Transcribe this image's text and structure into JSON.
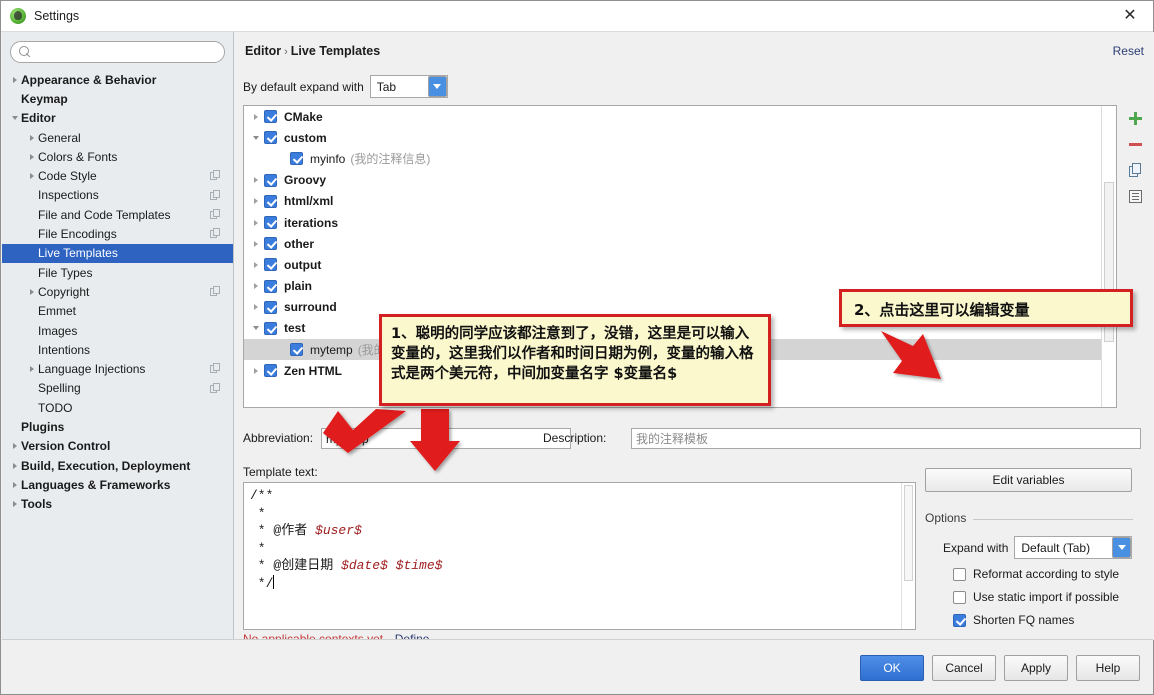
{
  "window": {
    "title": "Settings",
    "app_icon": "intellij-logo-icon",
    "close_label": "✕"
  },
  "sidebar": {
    "search": {
      "value": "",
      "placeholder": "",
      "icon": "search-icon"
    },
    "items": [
      {
        "label": "Appearance & Behavior",
        "level": 0,
        "bold": true,
        "arrow": "right",
        "badge": false,
        "selected": false
      },
      {
        "label": "Keymap",
        "level": 0,
        "bold": true,
        "arrow": "none",
        "badge": false,
        "selected": false
      },
      {
        "label": "Editor",
        "level": 0,
        "bold": true,
        "arrow": "down",
        "badge": false,
        "selected": false
      },
      {
        "label": "General",
        "level": 1,
        "bold": false,
        "arrow": "right",
        "badge": false,
        "selected": false
      },
      {
        "label": "Colors & Fonts",
        "level": 1,
        "bold": false,
        "arrow": "right",
        "badge": false,
        "selected": false
      },
      {
        "label": "Code Style",
        "level": 1,
        "bold": false,
        "arrow": "right",
        "badge": true,
        "selected": false
      },
      {
        "label": "Inspections",
        "level": 1,
        "bold": false,
        "arrow": "none",
        "badge": true,
        "selected": false
      },
      {
        "label": "File and Code Templates",
        "level": 1,
        "bold": false,
        "arrow": "none",
        "badge": true,
        "selected": false
      },
      {
        "label": "File Encodings",
        "level": 1,
        "bold": false,
        "arrow": "none",
        "badge": true,
        "selected": false
      },
      {
        "label": "Live Templates",
        "level": 1,
        "bold": false,
        "arrow": "none",
        "badge": false,
        "selected": true
      },
      {
        "label": "File Types",
        "level": 1,
        "bold": false,
        "arrow": "none",
        "badge": false,
        "selected": false
      },
      {
        "label": "Copyright",
        "level": 1,
        "bold": false,
        "arrow": "right",
        "badge": true,
        "selected": false
      },
      {
        "label": "Emmet",
        "level": 1,
        "bold": false,
        "arrow": "none",
        "badge": false,
        "selected": false
      },
      {
        "label": "Images",
        "level": 1,
        "bold": false,
        "arrow": "none",
        "badge": false,
        "selected": false
      },
      {
        "label": "Intentions",
        "level": 1,
        "bold": false,
        "arrow": "none",
        "badge": false,
        "selected": false
      },
      {
        "label": "Language Injections",
        "level": 1,
        "bold": false,
        "arrow": "right",
        "badge": true,
        "selected": false
      },
      {
        "label": "Spelling",
        "level": 1,
        "bold": false,
        "arrow": "none",
        "badge": true,
        "selected": false
      },
      {
        "label": "TODO",
        "level": 1,
        "bold": false,
        "arrow": "none",
        "badge": false,
        "selected": false
      },
      {
        "label": "Plugins",
        "level": 0,
        "bold": true,
        "arrow": "none",
        "badge": false,
        "selected": false
      },
      {
        "label": "Version Control",
        "level": 0,
        "bold": true,
        "arrow": "right",
        "badge": false,
        "selected": false
      },
      {
        "label": "Build, Execution, Deployment",
        "level": 0,
        "bold": true,
        "arrow": "right",
        "badge": false,
        "selected": false
      },
      {
        "label": "Languages & Frameworks",
        "level": 0,
        "bold": true,
        "arrow": "right",
        "badge": false,
        "selected": false
      },
      {
        "label": "Tools",
        "level": 0,
        "bold": true,
        "arrow": "right",
        "badge": false,
        "selected": false
      }
    ]
  },
  "main": {
    "breadcrumb": {
      "parent": "Editor",
      "separator": "›",
      "current": "Live Templates"
    },
    "reset_label": "Reset",
    "expand_with": {
      "label": "By default expand with",
      "value": "Tab"
    },
    "tree": [
      {
        "name": "CMake",
        "desc": "",
        "level": 0,
        "arrow": "right",
        "checked": true,
        "bold": true,
        "selected": false
      },
      {
        "name": "custom",
        "desc": "",
        "level": 0,
        "arrow": "down",
        "checked": true,
        "bold": true,
        "selected": false
      },
      {
        "name": "myinfo",
        "desc": "(我的注释信息)",
        "level": 1,
        "arrow": "none",
        "checked": true,
        "bold": false,
        "selected": false
      },
      {
        "name": "Groovy",
        "desc": "",
        "level": 0,
        "arrow": "right",
        "checked": true,
        "bold": true,
        "selected": false
      },
      {
        "name": "html/xml",
        "desc": "",
        "level": 0,
        "arrow": "right",
        "checked": true,
        "bold": true,
        "selected": false
      },
      {
        "name": "iterations",
        "desc": "",
        "level": 0,
        "arrow": "right",
        "checked": true,
        "bold": true,
        "selected": false
      },
      {
        "name": "other",
        "desc": "",
        "level": 0,
        "arrow": "right",
        "checked": true,
        "bold": true,
        "selected": false
      },
      {
        "name": "output",
        "desc": "",
        "level": 0,
        "arrow": "right",
        "checked": true,
        "bold": true,
        "selected": false
      },
      {
        "name": "plain",
        "desc": "",
        "level": 0,
        "arrow": "right",
        "checked": true,
        "bold": true,
        "selected": false
      },
      {
        "name": "surround",
        "desc": "",
        "level": 0,
        "arrow": "right",
        "checked": true,
        "bold": true,
        "selected": false
      },
      {
        "name": "test",
        "desc": "",
        "level": 0,
        "arrow": "down",
        "checked": true,
        "bold": true,
        "selected": false
      },
      {
        "name": "mytemp",
        "desc": "(我的",
        "level": 1,
        "arrow": "none",
        "checked": true,
        "bold": false,
        "selected": true
      },
      {
        "name": "Zen HTML",
        "desc": "",
        "level": 0,
        "arrow": "right",
        "checked": true,
        "bold": true,
        "selected": false
      }
    ],
    "toolbar_icons": [
      "add-icon",
      "remove-icon",
      "duplicate-icon",
      "change-context-icon"
    ],
    "abbreviation": {
      "label": "Abbreviation:",
      "value": "mytemp"
    },
    "description": {
      "label": "Description:",
      "value": "我的注释模板"
    },
    "template_text": {
      "label": "Template text:",
      "lines": [
        {
          "text": "/**",
          "vars": []
        },
        {
          "text": " *",
          "vars": []
        },
        {
          "text": " * @作者 ",
          "vars": [
            "$user$"
          ]
        },
        {
          "text": " *",
          "vars": []
        },
        {
          "text": " * @创建日期 ",
          "vars": [
            "$date$",
            "$time$"
          ]
        },
        {
          "text": " */",
          "vars": []
        }
      ],
      "raw": "/**\n *\n * @作者 $user$\n *\n * @创建日期 $date$ $time$\n */"
    },
    "context": {
      "warning": "No applicable contexts yet.",
      "define_link": "Define"
    }
  },
  "options": {
    "edit_variables_label": "Edit variables",
    "group_title": "Options",
    "expand_with": {
      "label": "Expand with",
      "value": "Default (Tab)"
    },
    "checkboxes": [
      {
        "label": "Reformat according to style",
        "checked": false
      },
      {
        "label": "Use static import if possible",
        "checked": false
      },
      {
        "label": "Shorten FQ names",
        "checked": true
      }
    ]
  },
  "footer": {
    "buttons": [
      {
        "label": "OK",
        "primary": true
      },
      {
        "label": "Cancel",
        "primary": false
      },
      {
        "label": "Apply",
        "primary": false
      },
      {
        "label": "Help",
        "primary": false
      }
    ]
  },
  "annotations": [
    {
      "id": 1,
      "text": "1、聪明的同学应该都注意到了，没错，这里是可以输入变量的，这里我们以作者和时间日期为例，变量的输入格式是两个美元符，中间加变量名字 $变量名$",
      "border_color": "#d32020",
      "fill_color": "#fbf8cd"
    },
    {
      "id": 2,
      "text": "2、点击这里可以编辑变量",
      "border_color": "#d32020",
      "fill_color": "#fbf8cd"
    }
  ]
}
